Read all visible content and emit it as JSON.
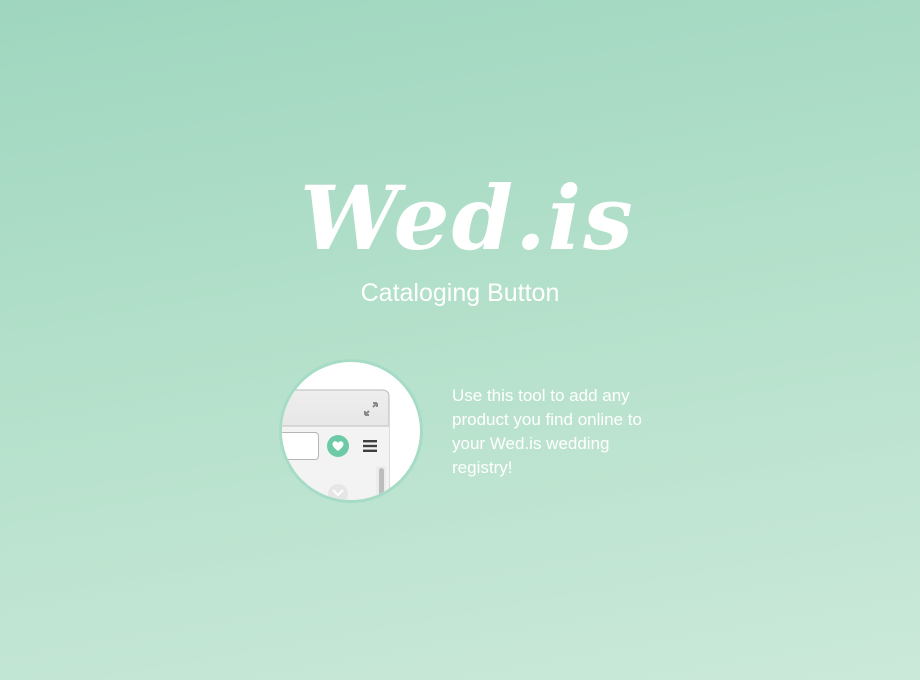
{
  "logo": {
    "text": "Wed.is"
  },
  "subtitle": "Cataloging Button",
  "description": "Use this tool to add any product you find online to your Wed.is wedding registry!",
  "preview": {
    "icons": [
      "expand-icon",
      "heart-icon",
      "menu-icon"
    ],
    "accent": "#6ccaa7"
  },
  "colors": {
    "background_top": "#9fd6bf",
    "background_bottom": "#cbe9d9",
    "circle_border": "#a6dcc6",
    "text": "#ffffff"
  }
}
